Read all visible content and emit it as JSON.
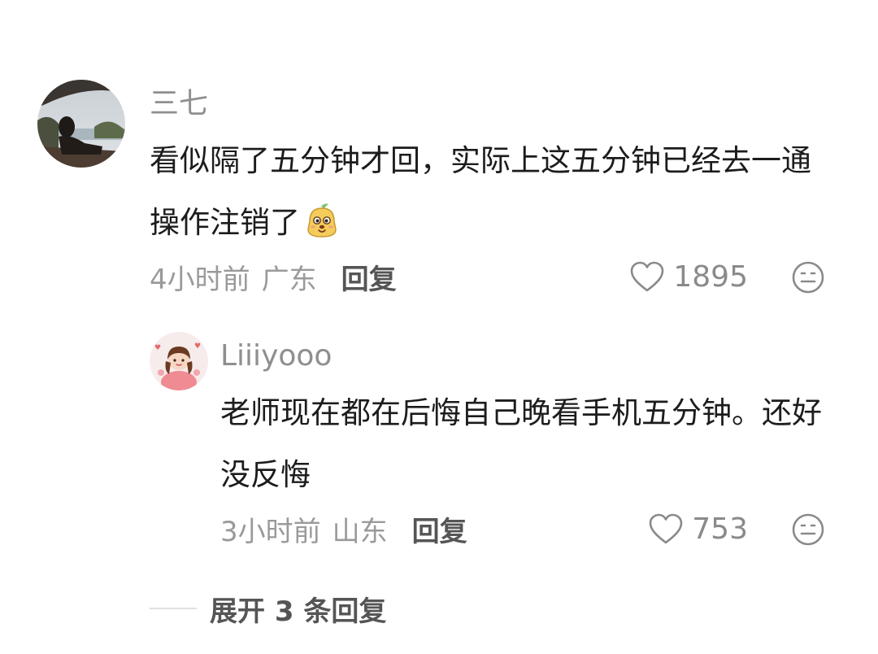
{
  "comment": {
    "username": "三七",
    "text": "看似隔了五分钟才回，实际上这五分钟已经去一通操作注销了",
    "time": "4小时前",
    "location": "广东",
    "reply_label": "回复",
    "likes": "1895",
    "emoji_icon": "smiling-potato-emoji"
  },
  "reply": {
    "username": "Liiiyooo",
    "text": "老师现在都在后悔自己晚看手机五分钟。还好没反悔",
    "time": "3小时前",
    "location": "山东",
    "reply_label": "回复",
    "likes": "753"
  },
  "expand": {
    "label": "展开 3 条回复"
  },
  "colors": {
    "username": "#8f8f8f",
    "meta": "#9a9a9a",
    "body_text": "#1c1c1c",
    "action_text": "#555555"
  }
}
